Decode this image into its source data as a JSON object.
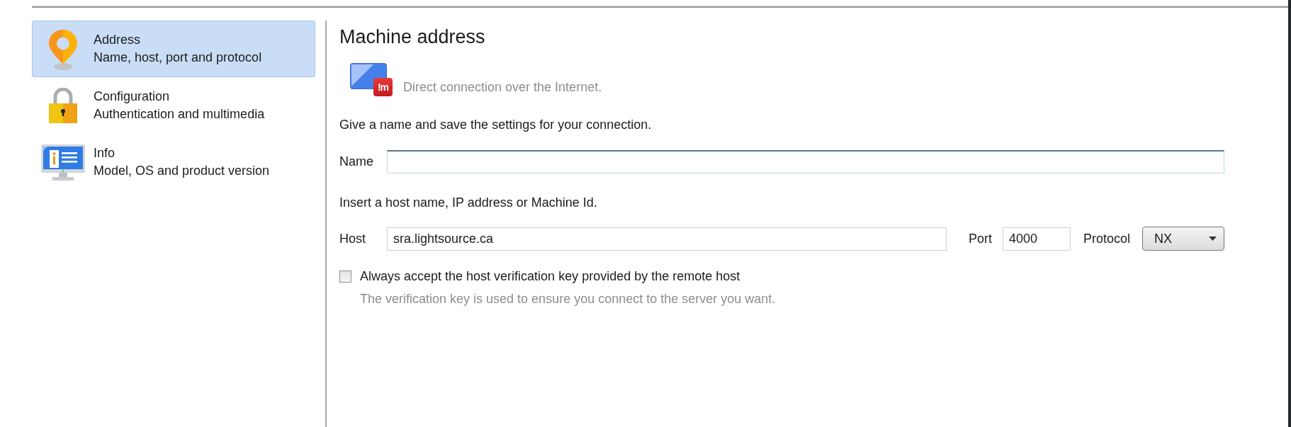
{
  "sidebar": {
    "items": [
      {
        "title": "Address",
        "subtitle": "Name, host, port and protocol",
        "selected": true
      },
      {
        "title": "Configuration",
        "subtitle": "Authentication and multimedia",
        "selected": false
      },
      {
        "title": "Info",
        "subtitle": "Model, OS and product version",
        "selected": false
      }
    ]
  },
  "panel": {
    "title": "Machine address",
    "connection": {
      "badge": "!m",
      "description": "Direct connection over the Internet."
    },
    "name_prompt": "Give a name and save the settings for your connection.",
    "name_field": {
      "label": "Name"
    },
    "host_prompt": "Insert a host name, IP address or Machine Id.",
    "host_field": {
      "label": "Host",
      "value": "sra.lightsource.ca"
    },
    "port_field": {
      "label": "Port",
      "value": "4000"
    },
    "protocol": {
      "label": "Protocol",
      "value": "NX"
    },
    "accept_key": {
      "label": "Always accept the host verification key provided by the remote host",
      "checked": false,
      "hint": "The verification key is used to ensure you connect to the server you want."
    }
  }
}
